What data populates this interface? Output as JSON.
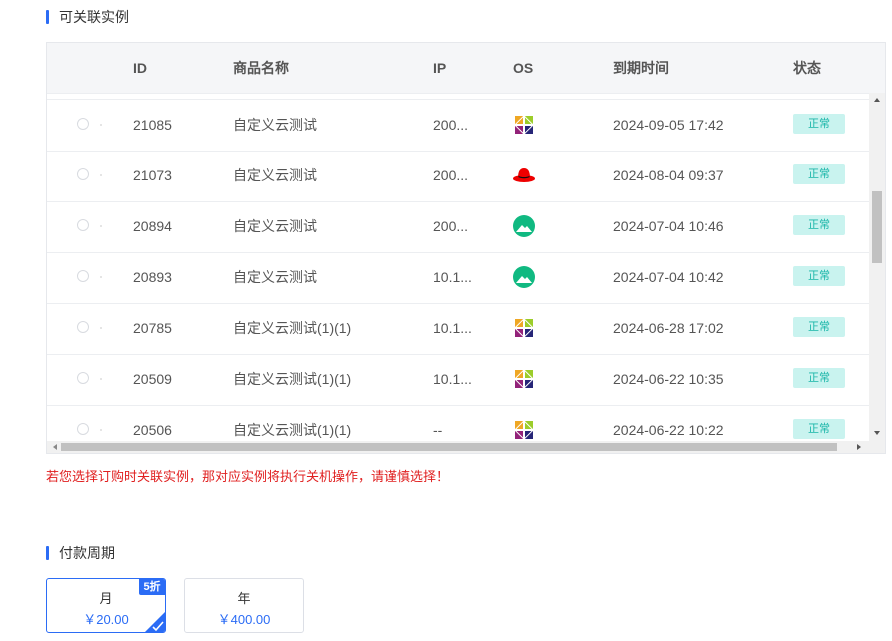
{
  "instances_section": {
    "title": "可关联实例",
    "columns": [
      "ID",
      "商品名称",
      "IP",
      "OS",
      "到期时间",
      "状态"
    ],
    "rows": [
      {
        "id": "21085",
        "name": "自定义云测试",
        "ip": "200...",
        "os": "centos-icon",
        "expire": "2024-09-05 17:42",
        "status": "正常"
      },
      {
        "id": "21073",
        "name": "自定义云测试",
        "ip": "200...",
        "os": "redhat-icon",
        "expire": "2024-08-04 09:37",
        "status": "正常"
      },
      {
        "id": "20894",
        "name": "自定义云测试",
        "ip": "200...",
        "os": "rocky-linux-icon",
        "expire": "2024-07-04 10:46",
        "status": "正常"
      },
      {
        "id": "20893",
        "name": "自定义云测试",
        "ip": "10.1...",
        "os": "rocky-linux-icon",
        "expire": "2024-07-04 10:42",
        "status": "正常"
      },
      {
        "id": "20785",
        "name": "自定义云测试(1)(1)",
        "ip": "10.1...",
        "os": "centos-icon",
        "expire": "2024-06-28 17:02",
        "status": "正常"
      },
      {
        "id": "20509",
        "name": "自定义云测试(1)(1)",
        "ip": "10.1...",
        "os": "centos-icon",
        "expire": "2024-06-22 10:35",
        "status": "正常"
      },
      {
        "id": "20506",
        "name": "自定义云测试(1)(1)",
        "ip": "--",
        "os": "centos-icon",
        "expire": "2024-06-22 10:22",
        "status": "正常"
      }
    ],
    "warning": "若您选择订购时关联实例，那对应实例将执行关机操作，请谨慎选择！"
  },
  "payment_section": {
    "title": "付款周期",
    "options": [
      {
        "name": "月",
        "price": "￥20.00",
        "discount": "5折",
        "selected": true
      },
      {
        "name": "年",
        "price": "￥400.00",
        "discount": "",
        "selected": false
      }
    ]
  },
  "colors": {
    "accent": "#2b6cf5",
    "status_text": "#1ab6a8",
    "status_bg": "#c9f3ef",
    "warning": "#e02020"
  }
}
